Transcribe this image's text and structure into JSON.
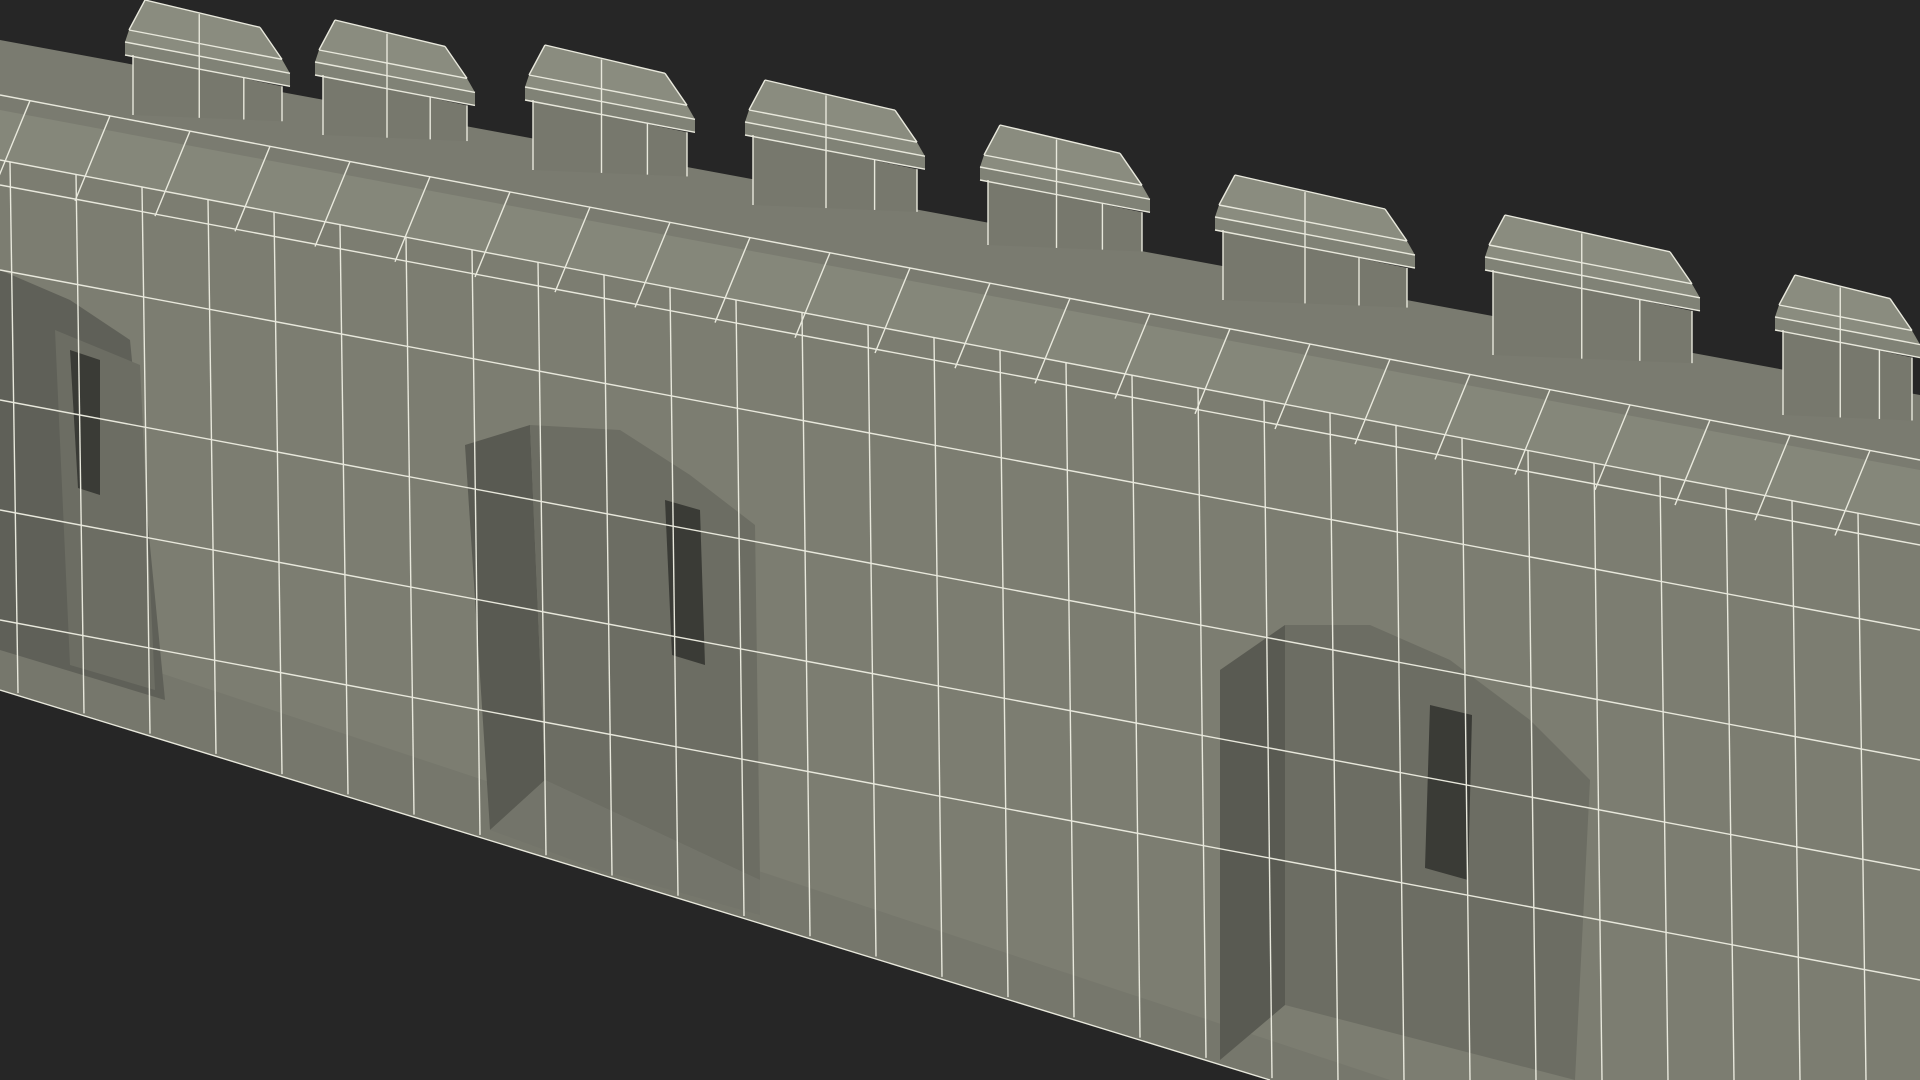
{
  "viewport": {
    "background_color": "#262626"
  },
  "model": {
    "subject": "castle-wall-with-crenellations",
    "display_mode": "wireframe-on-shaded",
    "colors": {
      "wall_front": "#7c7d71",
      "wall_top": "#85877a",
      "merlon_face": "#77786d",
      "merlon_cap": "#8a8c7f",
      "recess_dark": "#595a52",
      "recess_mid": "#6c6d63",
      "floor": "#76776c",
      "slit": "#3a3b36",
      "wire": "#e8e8dc"
    }
  }
}
